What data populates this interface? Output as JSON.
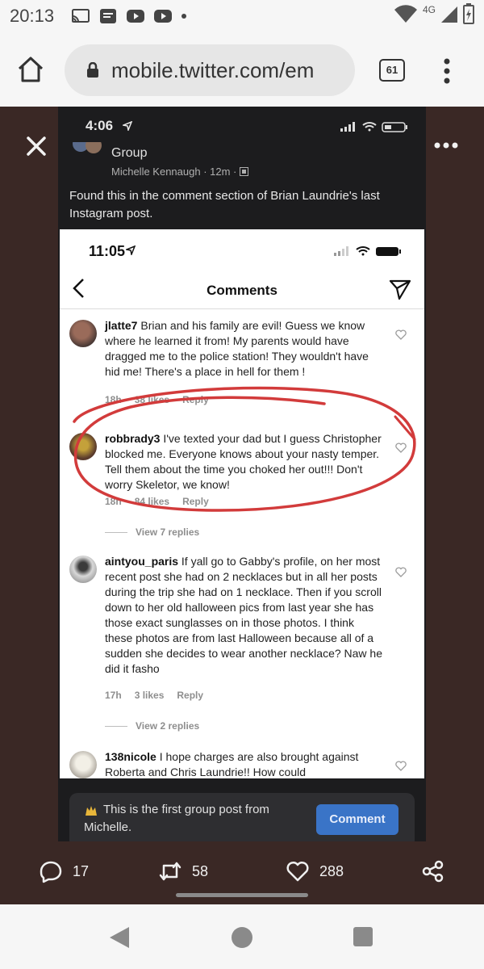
{
  "status_bar": {
    "time": "20:13",
    "network": "4G"
  },
  "browser": {
    "url": "mobile.twitter.com/em",
    "tab_count": "61"
  },
  "fb_post": {
    "status_time": "4:06",
    "group_label": "Group",
    "meta": "Michelle Kennaugh · 12m ·",
    "text": "Found this in the comment section of Brian Laundrie's last Instagram post."
  },
  "instagram": {
    "status_time": "11:05",
    "title": "Comments",
    "comments": [
      {
        "user": "jlatte7",
        "text": "Brian and his family are evil! Guess we know where he learned it from! My parents would have dragged me to the police station! They wouldn't have hid me! There's a place in hell for them !",
        "time": "18h",
        "likes": "38 likes",
        "reply": "Reply"
      },
      {
        "user": "robbrady3",
        "text": "I've texted your dad but I guess Christopher blocked me. Everyone knows about your nasty temper. Tell them about the time you choked her out!!! Don't worry Skeletor, we know!",
        "time": "18h",
        "likes": "84 likes",
        "reply": "Reply",
        "view_replies": "View 7 replies"
      },
      {
        "user": "aintyou_paris",
        "text": "If yall go to Gabby's profile, on her most recent post she had on 2 necklaces but in all her posts during the trip she had on 1 necklace. Then if you scroll down to her old halloween pics from last year she has those exact sunglasses on in those photos. I think these photos are from last Halloween because all of a sudden she decides to wear another necklace? Naw he did it fasho",
        "time": "17h",
        "likes": "3 likes",
        "reply": "Reply",
        "view_replies": "View 2 replies"
      },
      {
        "user": "138nicole",
        "text": "I hope charges are also brought against Roberta and Chris Laundrie!! How could"
      }
    ]
  },
  "fb_composer": {
    "text": "This is the first group post from Michelle.",
    "button": "Comment"
  },
  "tweet_actions": {
    "replies": "17",
    "retweets": "58",
    "likes": "288"
  },
  "icons": {
    "browser": [
      "home-icon",
      "lock-icon",
      "tab-switcher-icon",
      "more-vert-icon"
    ],
    "viewer": [
      "close-icon",
      "more-horiz-icon"
    ],
    "tweet": [
      "reply-icon",
      "retweet-icon",
      "heart-icon",
      "share-icon"
    ],
    "android_nav": [
      "back-icon",
      "home-icon",
      "recents-icon"
    ]
  },
  "colors": {
    "viewer_bg": "#3a2825",
    "fb_button": "#3a74c7",
    "annotation": "#d23b3b"
  }
}
